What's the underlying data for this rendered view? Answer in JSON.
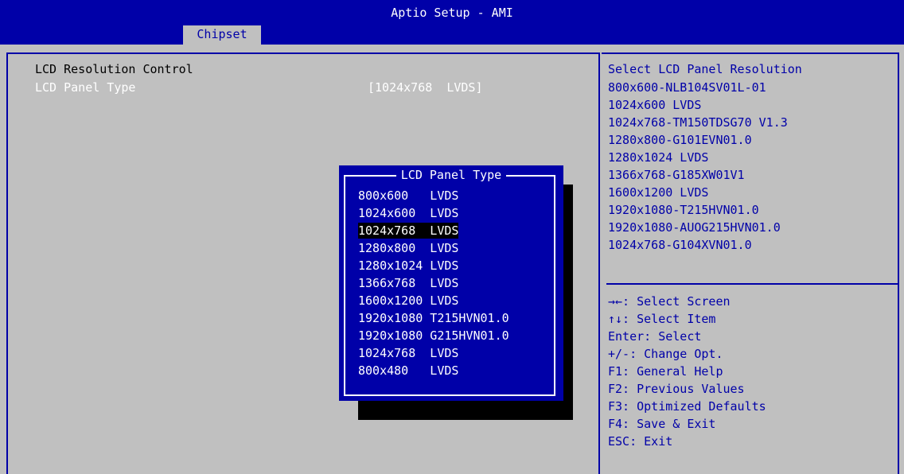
{
  "window": {
    "title": "Aptio Setup - AMI",
    "active_tab": "Chipset"
  },
  "main": {
    "section_heading": "LCD Resolution Control",
    "setting_label": "LCD Panel Type",
    "setting_value": "[1024x768  LVDS]"
  },
  "popup": {
    "title": "LCD Panel Type",
    "options": [
      "800x600   LVDS",
      "1024x600  LVDS",
      "1024x768  LVDS",
      "1280x800  LVDS",
      "1280x1024 LVDS",
      "1366x768  LVDS",
      "1600x1200 LVDS",
      "1920x1080 T215HVN01.0",
      "1920x1080 G215HVN01.0",
      "1024x768  LVDS",
      "800x480   LVDS"
    ],
    "selected_index": 2
  },
  "help": {
    "title": "Select LCD Panel Resolution",
    "lines": [
      "800x600-NLB104SV01L-01",
      "1024x600 LVDS",
      "1024x768-TM150TDSG70 V1.3",
      "1280x800-G101EVN01.0",
      "1280x1024 LVDS",
      "1366x768-G185XW01V1",
      "1600x1200 LVDS",
      "1920x1080-T215HVN01.0",
      "1920x1080-AUOG215HVN01.0",
      "1024x768-G104XVN01.0"
    ]
  },
  "keys": [
    "→←: Select Screen",
    "↑↓: Select Item",
    "Enter: Select",
    "+/-: Change Opt.",
    "F1: General Help",
    "F2: Previous Values",
    "F3: Optimized Defaults",
    "F4: Save & Exit",
    "ESC: Exit"
  ],
  "colors": {
    "bios_blue": "#0000a8",
    "background_gray": "#c0c0c0",
    "highlight_white": "#ffffff",
    "selection_black": "#000000"
  }
}
